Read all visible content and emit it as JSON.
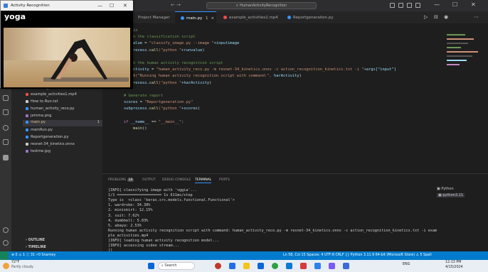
{
  "vscode": {
    "search_text": "HumanActivityRecognition",
    "tabs": [
      {
        "label": "Project Manager",
        "color": "#cccccc"
      },
      {
        "label": "main.py",
        "color": "#3794ff",
        "modified": "1"
      },
      {
        "label": "example_activities2.mp4",
        "color": "#f14c4c"
      },
      {
        "label": "Reportgeneration.py",
        "color": "#3794ff"
      }
    ],
    "close_glyph": "×"
  },
  "floating_window": {
    "title": "Activity Recognition",
    "label": "yoga",
    "controls": [
      "—",
      "☐",
      "✕"
    ]
  },
  "sidebar": {
    "files": [
      {
        "name": "example_activities3.mp4",
        "color": "#f14c4c"
      },
      {
        "name": "example_activities1.mp4",
        "color": "#f14c4c"
      },
      {
        "name": "How to Run.txt",
        "color": "#cccccc"
      },
      {
        "name": "human_activity_reco.py",
        "color": "#3794ff"
      },
      {
        "name": "jemma.png",
        "color": "#a074c4"
      },
      {
        "name": "main.py",
        "color": "#3794ff",
        "badge": "1"
      },
      {
        "name": "mainRun.py",
        "color": "#3794ff"
      },
      {
        "name": "Reportgeneration.py",
        "color": "#3794ff"
      },
      {
        "name": "resnet-34_kinetics.onnx",
        "color": "#cccccc"
      },
      {
        "name": "testme.jpg",
        "color": "#a074c4"
      }
    ],
    "outline_label": "OUTLINE",
    "timeline_label": "TIMELINE"
  },
  "editor": {
    "lines": [
      {
        "num": "",
        "segments": [
          {
            "t": "# main",
            "c": "cm"
          }
        ]
      },
      {
        "num": "",
        "segments": [
          {
            "t": "# Run the classification script",
            "c": "cm"
          }
        ]
      },
      {
        "num": "",
        "segments": [
          {
            "t": "runvalue",
            "c": "vr"
          },
          {
            "t": " = ",
            "c": "pl"
          },
          {
            "t": "\"classify_image.py --image \"",
            "c": "st"
          },
          {
            "t": "+inputimage",
            "c": "vr"
          }
        ]
      },
      {
        "num": "",
        "segments": [
          {
            "t": "subprocess",
            "c": "vr"
          },
          {
            "t": ".",
            "c": "pl"
          },
          {
            "t": "call",
            "c": "fn"
          },
          {
            "t": "(\"python \"",
            "c": "st"
          },
          {
            "t": "+runvalue",
            "c": "vr"
          },
          {
            "t": ")",
            "c": "pl"
          }
        ]
      },
      {
        "num": "",
        "segments": []
      },
      {
        "num": "",
        "segments": [
          {
            "t": "# Run the human activity recognition script",
            "c": "cm"
          }
        ]
      },
      {
        "num": "",
        "segments": [
          {
            "t": "harActivity",
            "c": "vr"
          },
          {
            "t": " = ",
            "c": "pl"
          },
          {
            "t": "\"human_activity_reco.py -m resnet-34_kinetics.onnx -c action_recognition_kinetics.txt -i \"",
            "c": "st"
          },
          {
            "t": "+args[\"input\"]",
            "c": "vr"
          }
        ]
      },
      {
        "num": "",
        "segments": [
          {
            "t": "print",
            "c": "fn"
          },
          {
            "t": "(\"Running human activity recognition script with command:\", ",
            "c": "st"
          },
          {
            "t": "harActivity",
            "c": "vr"
          },
          {
            "t": ")",
            "c": "pl"
          }
        ]
      },
      {
        "num": "",
        "segments": [
          {
            "t": "subprocess",
            "c": "vr"
          },
          {
            "t": ".",
            "c": "pl"
          },
          {
            "t": "call",
            "c": "fn"
          },
          {
            "t": "(\"python \"",
            "c": "st"
          },
          {
            "t": "+harActivity",
            "c": "vr"
          },
          {
            "t": ")",
            "c": "pl"
          }
        ]
      },
      {
        "num": "",
        "segments": []
      },
      {
        "num": "",
        "segments": [
          {
            "t": "# Generate report",
            "c": "cm"
          }
        ]
      },
      {
        "num": "",
        "segments": [
          {
            "t": "scores",
            "c": "vr"
          },
          {
            "t": " = ",
            "c": "pl"
          },
          {
            "t": "\"Reportgeneration.py\"",
            "c": "st"
          }
        ]
      },
      {
        "num": "",
        "segments": [
          {
            "t": "subprocess",
            "c": "vr"
          },
          {
            "t": ".",
            "c": "pl"
          },
          {
            "t": "call",
            "c": "fn"
          },
          {
            "t": "(\"python \"",
            "c": "st"
          },
          {
            "t": "+scores",
            "c": "vr"
          },
          {
            "t": ")",
            "c": "pl"
          }
        ]
      },
      {
        "num": "",
        "segments": []
      },
      {
        "num": "",
        "segments": [
          {
            "t": "if ",
            "c": "kw"
          },
          {
            "t": "__name__",
            "c": "vr"
          },
          {
            "t": " == ",
            "c": "pl"
          },
          {
            "t": "\"__main__\"",
            "c": "st"
          },
          {
            "t": ":",
            "c": "pl"
          }
        ]
      },
      {
        "num": "",
        "segments": [
          {
            "t": "    main",
            "c": "fn"
          },
          {
            "t": "()",
            "c": "pl"
          }
        ]
      },
      {
        "num": "",
        "segments": []
      }
    ]
  },
  "panel": {
    "tabs": [
      "PROBLEMS",
      "OUTPUT",
      "DEBUG CONSOLE",
      "TERMINAL",
      "PORTS"
    ],
    "problems_count": "10",
    "terminal_lines": [
      "[INFO] classifying image with 'vggia'...",
      "1/1 ━━━━━━━━━━━━━━━━━━━━ 1s 611ms/step",
      "Type is  <class 'keras.src.models.functional.Functional'>",
      "1. wardrobe: 34.38%",
      "2. miniskirt: 12.15%",
      "3. suit: 7.62%",
      "4. dumbbell: 5.03%",
      "5. abaya: 2.53%",
      "Running human activity recognition script with command: human_activity_reco.py -m resnet-34_kinetics.onnx -c action_recognition_kinetics.txt -i exam",
      "ple_activities.mp4",
      "[INFO] loading human activity recognition model...",
      "[INFO] accessing video stream...",
      "[]"
    ],
    "terminals": [
      "Python",
      "python3.11"
    ]
  },
  "statusbar": {
    "left": "⊗ 0 ⚠ 1 ⓘ 31   ⚡0   Snarney",
    "right": "Ln 58, Col 15   Spaces: 4   UTF-8   CRLF   {} Python   3.11.9 64-bit (Microsoft Store)   ⚠ 5 Spell"
  },
  "taskbar": {
    "weather": "72°F",
    "weather_sub": "Partly cloudy",
    "search": "Search",
    "lang": "ENG",
    "time": "12:13 PM",
    "date": "4/15/2024"
  }
}
